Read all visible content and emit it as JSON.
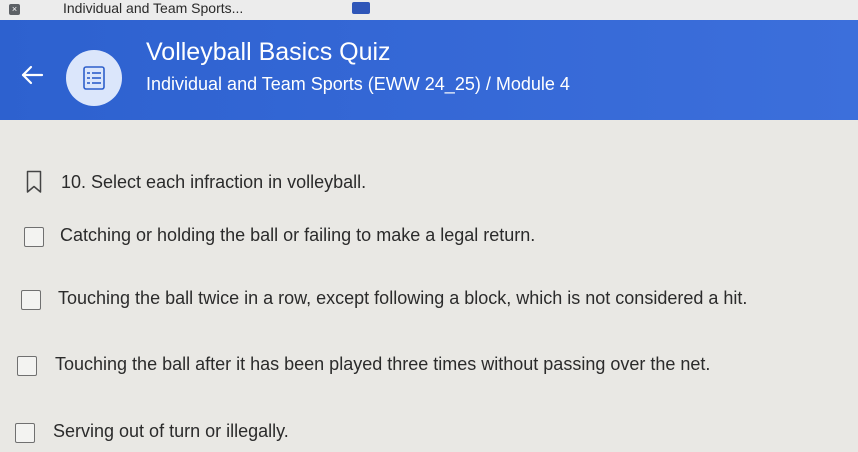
{
  "browser": {
    "tab_title": "Individual and Team Sports...",
    "favicon_glyph": "×"
  },
  "header": {
    "title": "Volleyball Basics Quiz",
    "subtitle": "Individual and Team Sports (EWW 24_25) / Module 4",
    "back_icon": "arrow-left-icon",
    "quiz_icon": "quiz-list-icon"
  },
  "question": {
    "text": "10. Select each infraction in volleyball.",
    "bookmark_icon": "bookmark-icon",
    "options": [
      {
        "label": "Catching or holding the ball or failing to make a legal return.",
        "checked": false
      },
      {
        "label": "Touching the ball twice in a row, except following a block, which is not considered a hit.",
        "checked": false
      },
      {
        "label": "Touching the ball after it has been played three times without passing over the net.",
        "checked": false
      },
      {
        "label": "Serving out of turn or illegally.",
        "checked": false
      }
    ]
  },
  "colors": {
    "header_blue": "#3366d4",
    "page_bg": "#e9e8e4"
  }
}
